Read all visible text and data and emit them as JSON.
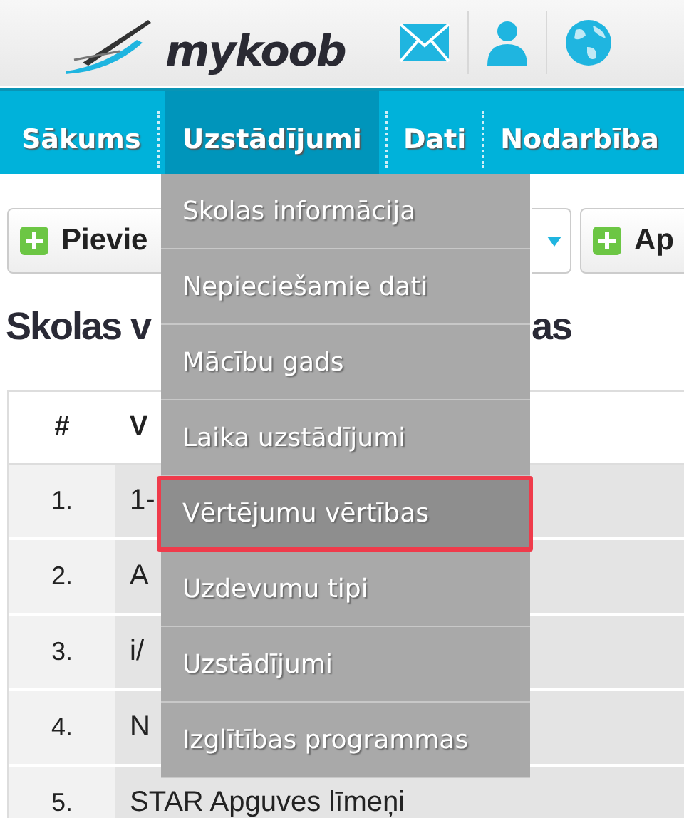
{
  "header": {
    "logo": "mykoob"
  },
  "nav": [
    {
      "label": "Sākums",
      "selected": false
    },
    {
      "label": "Uzstādījumi",
      "selected": true
    },
    {
      "label": "Dati",
      "selected": false
    },
    {
      "label": "Nodarbība",
      "selected": false
    }
  ],
  "toolbar": {
    "buttons": [
      "Pievie",
      "Ap"
    ]
  },
  "title": [
    "Skolas v",
    "as"
  ],
  "table": {
    "columns": [
      "#",
      "V"
    ],
    "rows": [
      {
        "num": "1.",
        "name": "1-"
      },
      {
        "num": "2.",
        "name": "A"
      },
      {
        "num": "3.",
        "name": "i/"
      },
      {
        "num": "4.",
        "name": "N"
      },
      {
        "num": "5.",
        "name": "STAR Apguves līmeņi"
      }
    ]
  },
  "menu": [
    {
      "label": "Skolas informācija",
      "selected": false
    },
    {
      "label": "Nepieciešamie dati",
      "selected": false
    },
    {
      "label": "Mācību gads",
      "selected": false
    },
    {
      "label": "Laika uzstādījumi",
      "selected": false
    },
    {
      "label": "Vērtējumu vērtības",
      "selected": true
    },
    {
      "label": "Uzdevumu tipi",
      "selected": false
    },
    {
      "label": "Uzstādījumi",
      "selected": false
    },
    {
      "label": "Izglītības programmas",
      "selected": false
    }
  ]
}
